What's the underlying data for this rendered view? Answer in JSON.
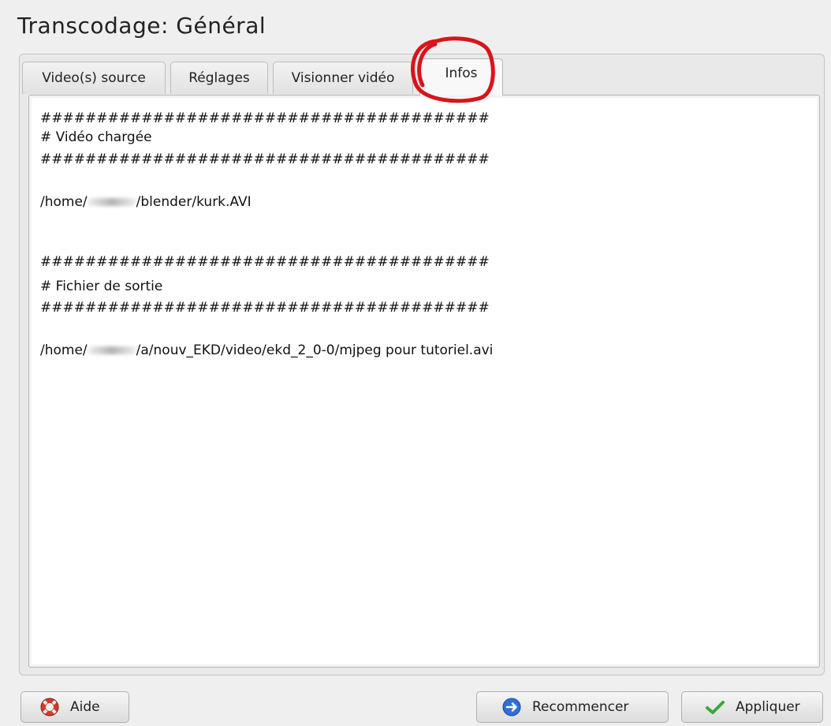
{
  "window": {
    "title": "Transcodage: Général"
  },
  "tabs": [
    {
      "label": "Video(s) source"
    },
    {
      "label": "Réglages"
    },
    {
      "label": "Visionner vidéo"
    },
    {
      "label": "Infos",
      "active": true
    }
  ],
  "info": {
    "separator": "########################################",
    "loaded_heading": "# Vidéo chargée",
    "loaded_path_prefix": "/home/",
    "loaded_path_suffix": "/blender/kurk.AVI",
    "output_heading": "# Fichier de sortie",
    "output_path_prefix": "/home/",
    "output_path_suffix": "/a/nouv_EKD/video/ekd_2_0-0/mjpeg pour tutoriel.avi"
  },
  "buttons": {
    "help": "Aide",
    "reset": "Recommencer",
    "apply": "Appliquer"
  },
  "colors": {
    "annotation_circle": "#d8141c",
    "apply_check": "#3aa83a",
    "reset_icon": "#2f6fd6",
    "help_icon": "#d23b2b"
  },
  "icons": {
    "help": "lifebuoy-icon",
    "reset": "circle-arrow-right-icon",
    "apply": "checkmark-icon"
  }
}
